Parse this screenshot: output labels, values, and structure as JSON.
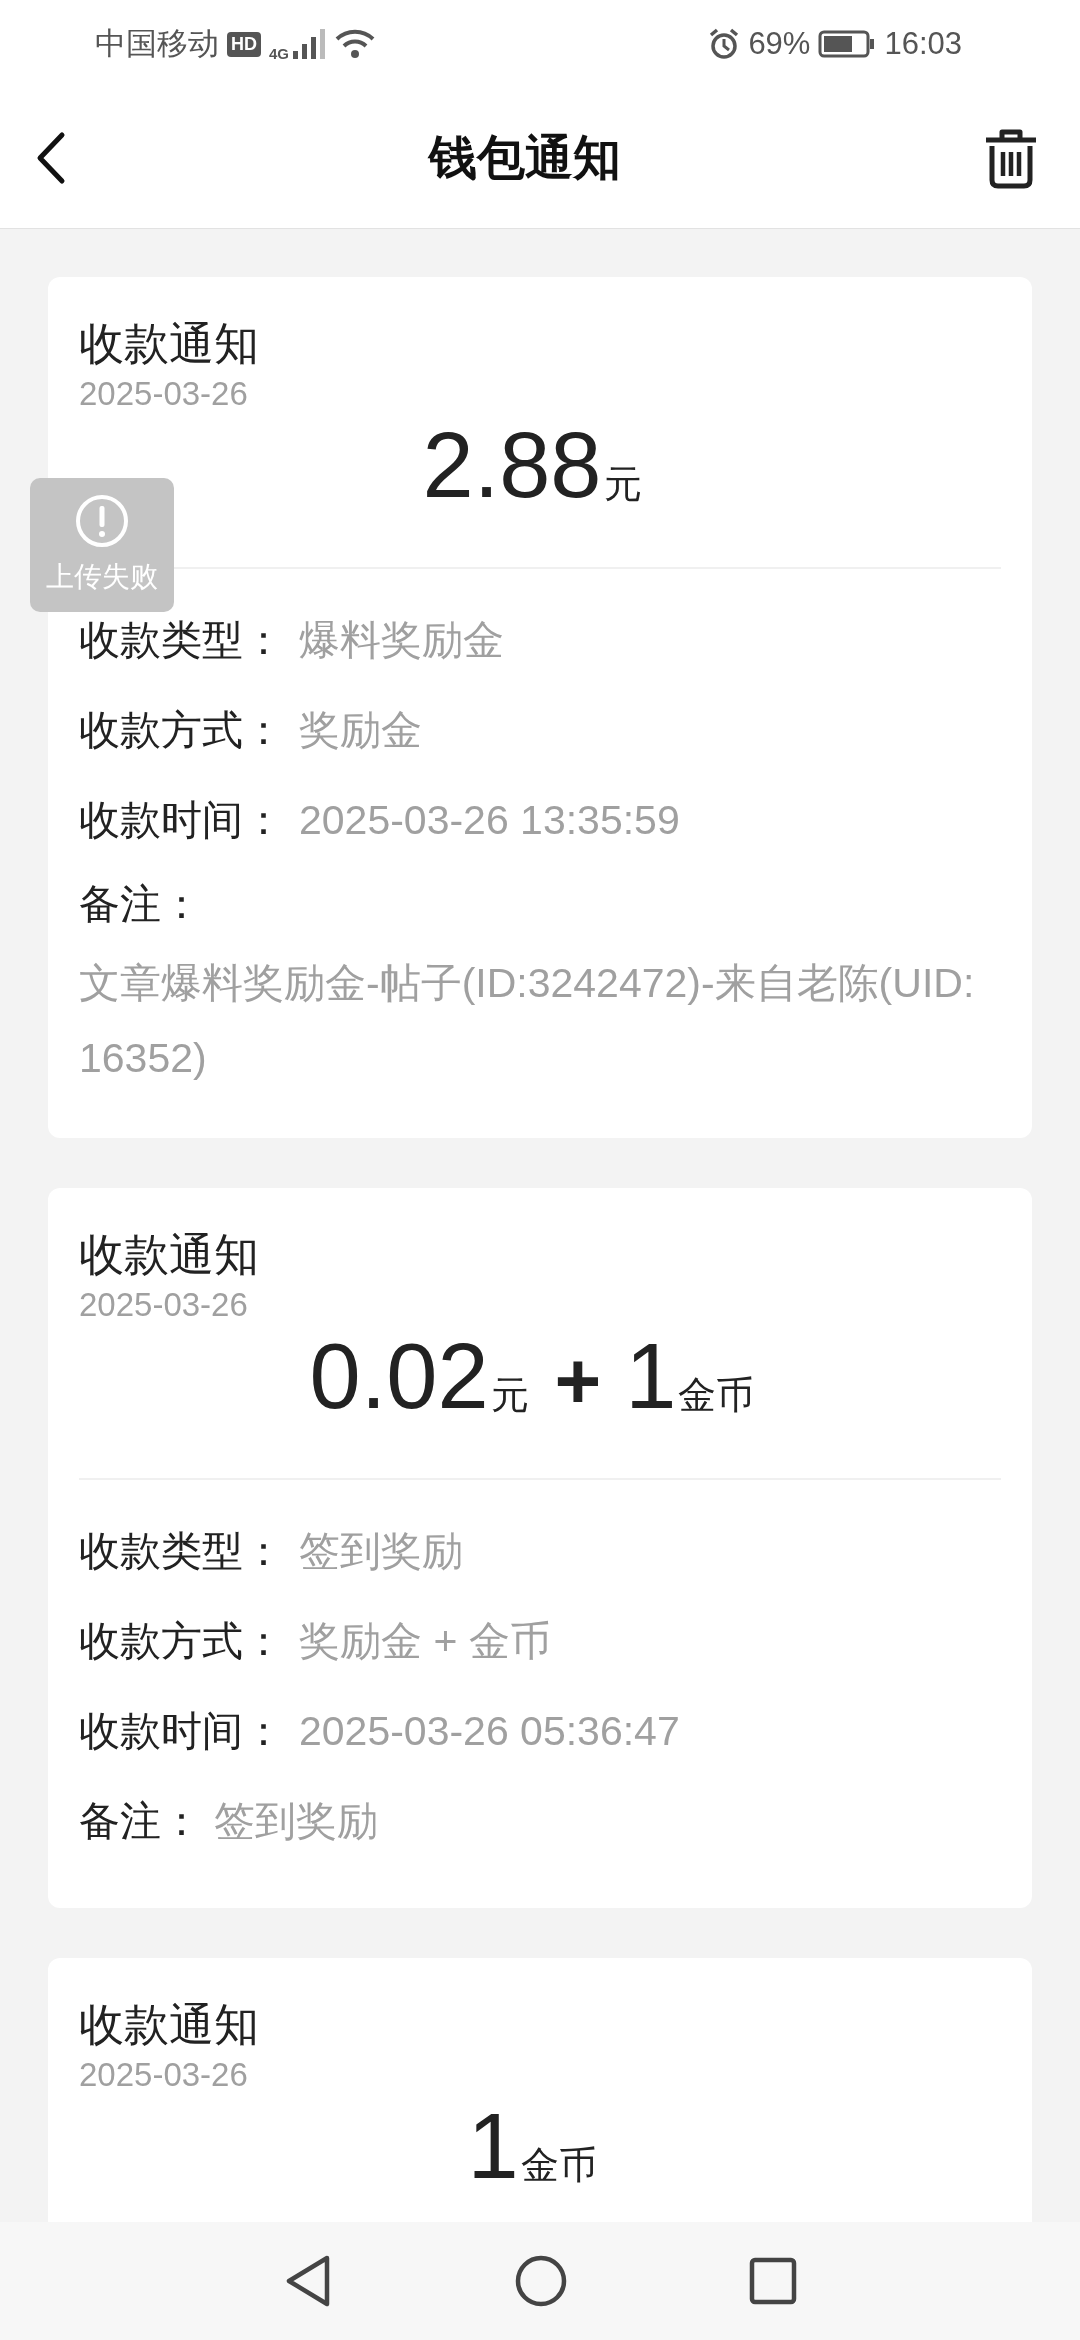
{
  "status_bar": {
    "carrier": "中国移动",
    "hd": "HD",
    "network": "4G",
    "battery": "69%",
    "time": "16:03"
  },
  "header": {
    "title": "钱包通知"
  },
  "notifications": [
    {
      "title": "收款通知",
      "date": "2025-03-26",
      "amount": [
        {
          "kind": "number",
          "text": "2.88"
        },
        {
          "kind": "unit",
          "text": "元"
        }
      ],
      "fields": [
        {
          "kind": "inline",
          "label": "收款类型：",
          "value": "爆料奖励金"
        },
        {
          "kind": "inline",
          "label": "收款方式：",
          "value": "奖励金"
        },
        {
          "kind": "inline",
          "label": "收款时间：",
          "value": "2025-03-26 13:35:59"
        },
        {
          "kind": "block",
          "label": "备注：",
          "value": "文章爆料奖励金-帖子(ID:3242472)-来自老陈(UID:16352)"
        }
      ]
    },
    {
      "title": "收款通知",
      "date": "2025-03-26",
      "amount": [
        {
          "kind": "number",
          "text": "0.02"
        },
        {
          "kind": "unit",
          "text": "元"
        },
        {
          "kind": "plus",
          "text": "+"
        },
        {
          "kind": "number",
          "text": "1"
        },
        {
          "kind": "unit",
          "text": "金币"
        }
      ],
      "fields": [
        {
          "kind": "inline",
          "label": "收款类型：",
          "value": "签到奖励"
        },
        {
          "kind": "inline",
          "label": "收款方式：",
          "value": "奖励金 + 金币"
        },
        {
          "kind": "inline",
          "label": "收款时间：",
          "value": "2025-03-26 05:36:47"
        },
        {
          "kind": "short",
          "label": "备注：",
          "value": "签到奖励"
        }
      ]
    },
    {
      "title": "收款通知",
      "date": "2025-03-26",
      "amount": [
        {
          "kind": "number",
          "text": "1"
        },
        {
          "kind": "unit",
          "text": "金币"
        }
      ]
    }
  ],
  "toast": {
    "message": "上传失败"
  }
}
